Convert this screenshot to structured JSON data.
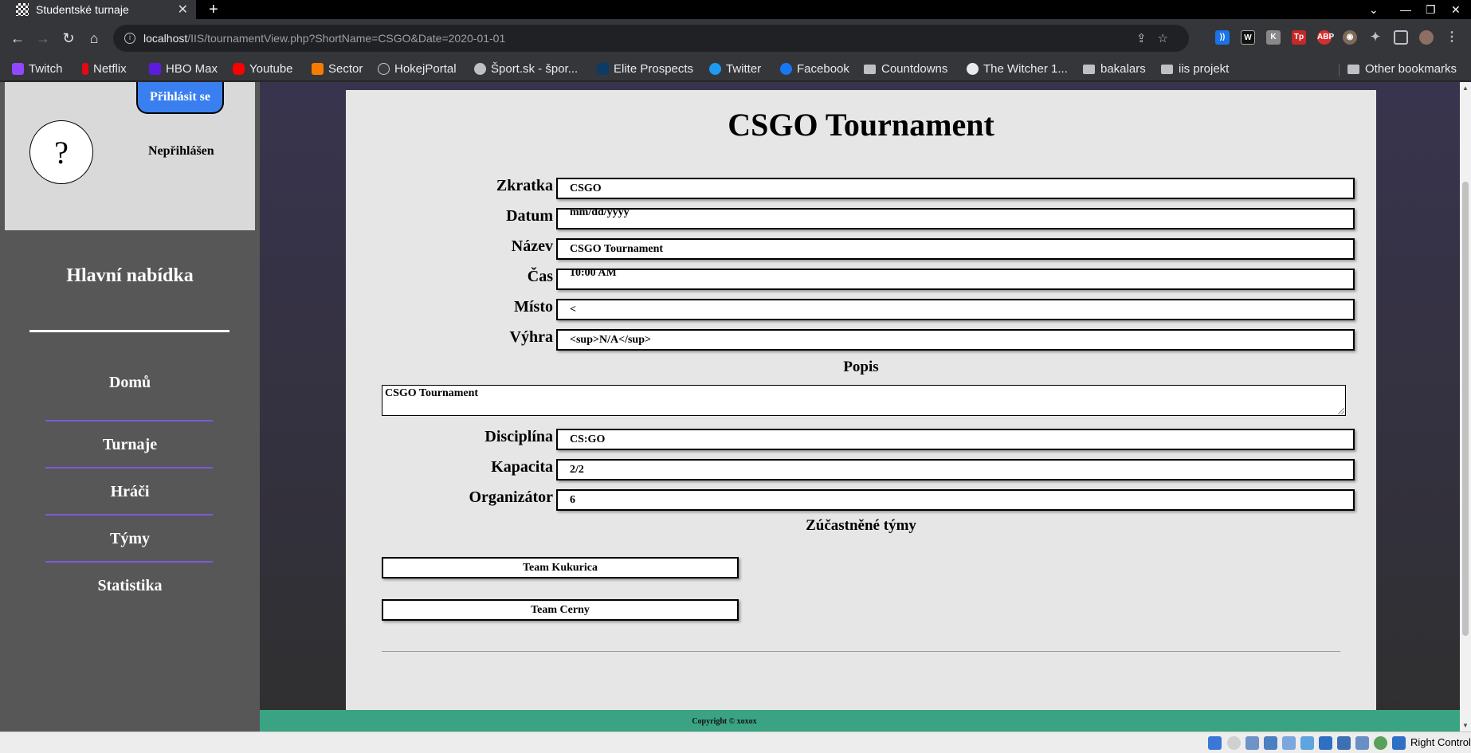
{
  "browser": {
    "tab_title": "Studentské turnaje",
    "url_host": "localhost",
    "url_path": "/IIS/tournamentView.php?ShortName=CSGO&Date=2020-01-01",
    "bookmarks": [
      "Twitch",
      "Netflix",
      "HBO Max",
      "Youtube",
      "Sector",
      "HokejPortal",
      "Šport.sk - špor...",
      "Elite Prospects",
      "Twitter",
      "Facebook",
      "Countdowns",
      "The Witcher 1...",
      "bakalars",
      "iis projekt"
    ],
    "other_bookmarks": "Other bookmarks"
  },
  "sidebar": {
    "avatar_symbol": "?",
    "login_button": "Přihlásit se",
    "login_status": "Nepřihlášen",
    "menu_title": "Hlavní nabídka",
    "menu_items": [
      "Domů",
      "Turnaje",
      "Hráči",
      "Týmy",
      "Statistika"
    ]
  },
  "tournament": {
    "title": "CSGO Tournament",
    "fields": [
      {
        "label": "Zkratka",
        "value": "CSGO"
      },
      {
        "label": "Datum",
        "value": "mm/dd/yyyy"
      },
      {
        "label": "Název",
        "value": "CSGO Tournament"
      },
      {
        "label": "Čas",
        "value": "10:00 AM"
      },
      {
        "label": "Místo",
        "value": "<"
      },
      {
        "label": "Výhra",
        "value": "<sup>N/A</sup>"
      }
    ],
    "description_heading": "Popis",
    "description": "CSGO Tournament",
    "fields2": [
      {
        "label": "Disciplína",
        "value": "CS:GO"
      },
      {
        "label": "Kapacita",
        "value": "2/2"
      },
      {
        "label": "Organizátor",
        "value": "6"
      }
    ],
    "teams_heading": "Zúčastněné týmy",
    "teams": [
      "Team Kukurica",
      "Team Cerny"
    ]
  },
  "footer": {
    "text": "Copyright © xoxox"
  },
  "statusbar": {
    "host_key": "Right Control"
  }
}
